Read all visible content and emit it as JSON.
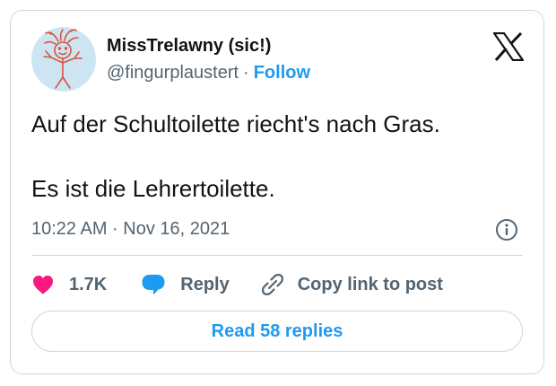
{
  "author": {
    "display_name": "MissTrelawny (sic!)",
    "handle": "@fingurplaustert",
    "separator": "·",
    "follow_label": "Follow"
  },
  "tweet": {
    "lines": [
      "Auf der Schultoilette riecht's nach Gras.",
      "Es ist die Lehrertoilette."
    ],
    "timestamp": "10:22 AM · Nov 16, 2021"
  },
  "actions": {
    "like_count": "1.7K",
    "reply_label": "Reply",
    "copy_link_label": "Copy link to post"
  },
  "footer": {
    "read_replies_label": "Read 58 replies"
  },
  "icons": {
    "brand": "x-logo-icon",
    "info": "info-icon",
    "like": "heart-icon",
    "reply": "speech-bubble-icon",
    "copy_link": "link-icon"
  },
  "colors": {
    "accent": "#1d9bf0",
    "like": "#f91880",
    "text": "#0f1419",
    "secondary": "#536471",
    "border": "#cfd9de",
    "avatar_bg": "#cde4f3",
    "avatar_drawing": "#d9553a"
  }
}
